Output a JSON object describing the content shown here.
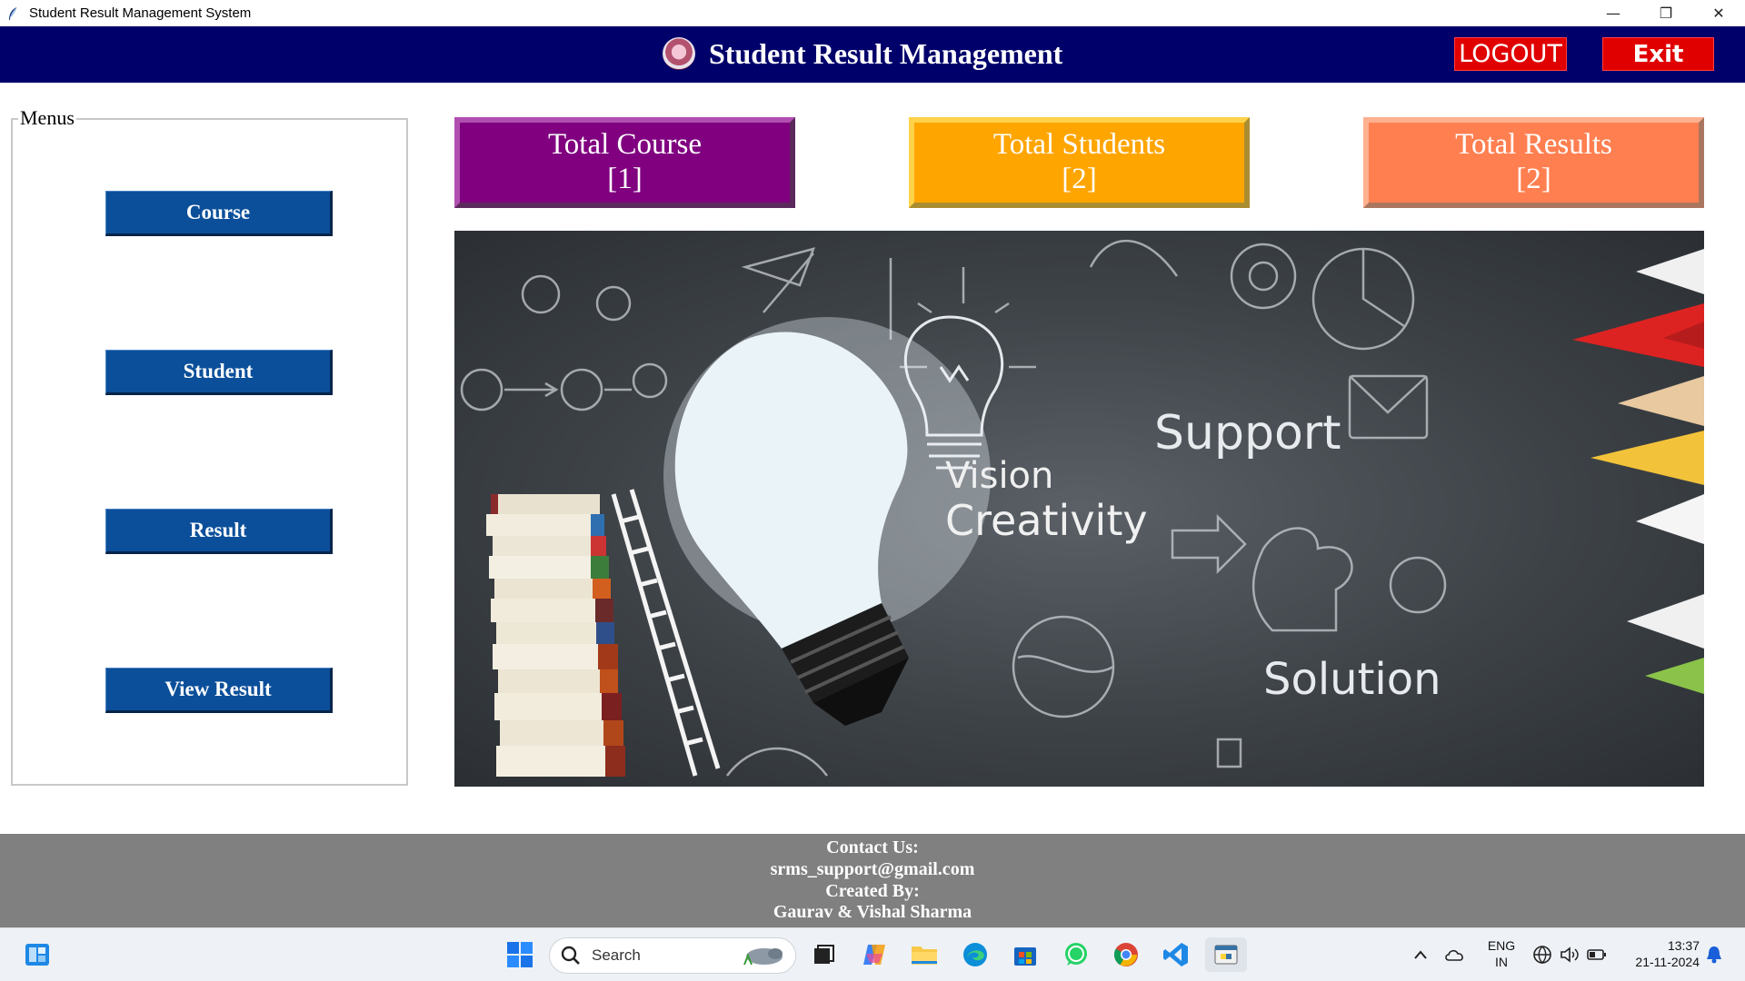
{
  "window": {
    "title": "Student Result Management System",
    "controls": {
      "minimize": "—",
      "restore": "❐",
      "close": "✕"
    }
  },
  "header": {
    "title": "Student Result Management",
    "logout_label": "LOGOUT",
    "exit_label": "Exit",
    "background": "#00006b"
  },
  "menus": {
    "legend": "Menus",
    "items": [
      {
        "label": "Course"
      },
      {
        "label": "Student"
      },
      {
        "label": "Result"
      },
      {
        "label": "View Result"
      }
    ],
    "button_color": "#0b4f9a"
  },
  "cards": [
    {
      "title": "Total Course",
      "value": "[1]",
      "color": "#800080"
    },
    {
      "title": "Total Students",
      "value": "[2]",
      "color": "#ffa500"
    },
    {
      "title": "Total Results",
      "value": "[2]",
      "color": "#ff7f50"
    }
  ],
  "banner": {
    "texts": [
      "Vision",
      "Creativity",
      "Support",
      "Solution"
    ]
  },
  "footer": {
    "contact_heading": "Contact Us:",
    "email": "srms_support@gmail.com",
    "created_heading": "Created By:",
    "authors": "Gaurav & Vishal Sharma"
  },
  "taskbar": {
    "search_placeholder": "Search",
    "lang_top": "ENG",
    "lang_bottom": "IN",
    "time": "13:37",
    "date": "21-11-2024",
    "apps": [
      "start-icon",
      "search-icon",
      "task-view-icon",
      "copilot-icon",
      "file-explorer-icon",
      "edge-icon",
      "store-icon",
      "whatsapp-icon",
      "chrome-icon",
      "vscode-icon",
      "python-app-icon"
    ]
  }
}
